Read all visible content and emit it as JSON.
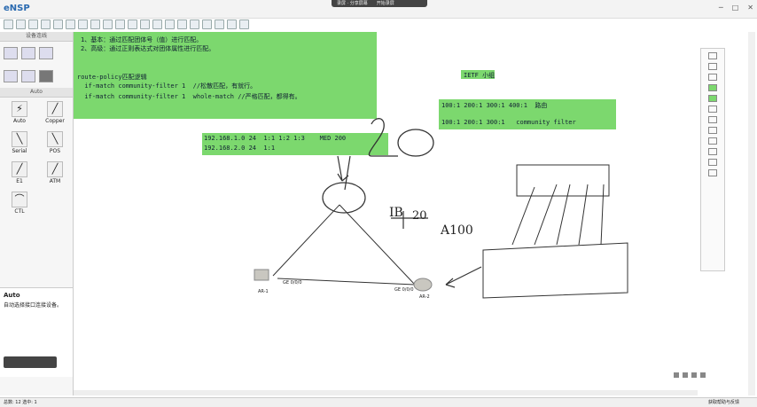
{
  "app": {
    "title": "eNSP"
  },
  "recorder": {
    "btn1": "录屏 · 分享屏幕",
    "btn2": "开始录屏"
  },
  "window_controls": [
    "─",
    "□",
    "✕"
  ],
  "left_panel": {
    "devices_title": "设备连线",
    "cables_title": "Auto",
    "cables": [
      "Auto",
      "Copper",
      "Serial",
      "POS",
      "E1",
      "ATM",
      "CTL"
    ],
    "desc_title": "Auto",
    "desc_body": "自动选择接口连接设备。"
  },
  "notes": {
    "line1": "1、基本：通过匹配团体号（值）进行匹配。",
    "line2": "2、高级：通过正则表达式对团体属性进行匹配。",
    "line3": "route-policy匹配逻辑",
    "line4": "  if-match community-filter 1  //松散匹配，有就行。",
    "line5": "  if-match community-filter 1  whole-match //严格匹配，都得有。"
  },
  "routes": {
    "r1": "192.168.1.0 24  1:1 1:2 1:3    MED 200",
    "r2": "192.168.2.0 24  1:1"
  },
  "ietf": {
    "title": "IETF 小组",
    "l1": "100:1 200:1 300:1 400:1  路由",
    "l2": "100:1 200:1 300:1   community filter"
  },
  "topology": {
    "ar1": "AR-1",
    "ar2": "AR-2",
    "ar1_port": "GE 0/0/0",
    "ar2_port": "GE 0/0/0"
  },
  "handwriting": {
    "n20": "20",
    "ib": "IB",
    "a100": "A100",
    "c20": "20"
  },
  "status": {
    "left": "总数: 12 选中: 1",
    "right": "获取帮助与反馈"
  }
}
